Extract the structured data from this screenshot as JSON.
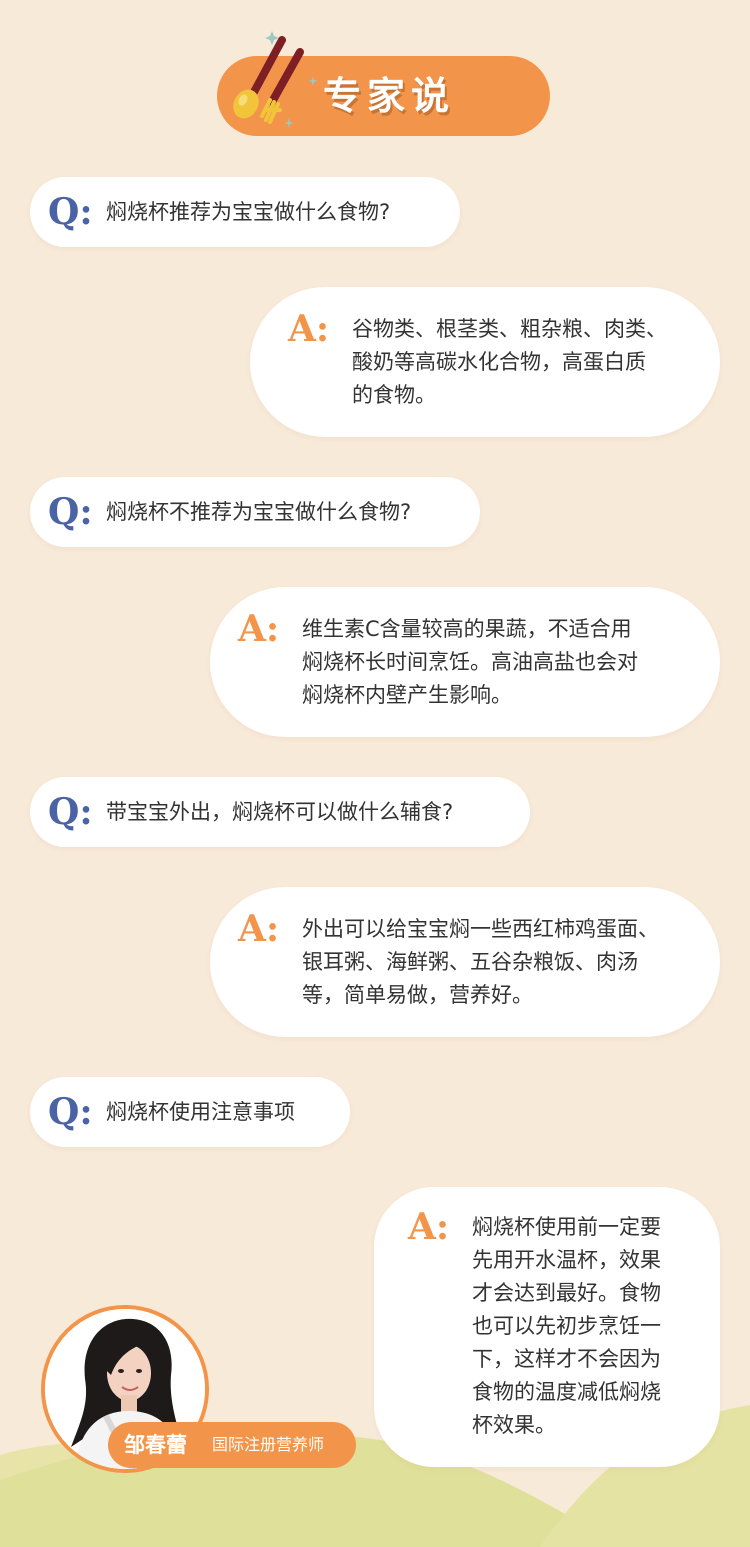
{
  "header": {
    "title": "专家说"
  },
  "qa": [
    {
      "q_mark": "Q:",
      "question": "焖烧杯推荐为宝宝做什么食物?",
      "a_mark": "A:",
      "answer_lines": [
        "谷物类、根茎类、粗杂粮、肉类、",
        "酸奶等高碳水化合物，高蛋白质",
        "的食物。"
      ]
    },
    {
      "q_mark": "Q:",
      "question": "焖烧杯不推荐为宝宝做什么食物?",
      "a_mark": "A:",
      "answer_lines": [
        "维生素C含量较高的果蔬，不适合用",
        "焖烧杯长时间烹饪。高油高盐也会对",
        "焖烧杯内壁产生影响。"
      ]
    },
    {
      "q_mark": "Q:",
      "question": "带宝宝外出，焖烧杯可以做什么辅食?",
      "a_mark": "A:",
      "answer_lines": [
        "外出可以给宝宝焖一些西红柿鸡蛋面、",
        "银耳粥、海鲜粥、五谷杂粮饭、肉汤",
        "等，简单易做，营养好。"
      ]
    },
    {
      "q_mark": "Q:",
      "question": "焖烧杯使用注意事项",
      "a_mark": "A:",
      "answer_lines": [
        "焖烧杯使用前一定要",
        "先用开水温杯，效果",
        "才会达到最好。食物",
        "也可以先初步烹饪一",
        "下，这样才不会因为",
        "食物的温度减低焖烧",
        "杯效果。"
      ]
    }
  ],
  "expert": {
    "name": "邹春蕾",
    "title": "国际注册营养师"
  },
  "colors": {
    "background": "#f8ead9",
    "accent": "#f2954a",
    "q_mark": "#4a63a6",
    "hills": "#dfe09a"
  }
}
